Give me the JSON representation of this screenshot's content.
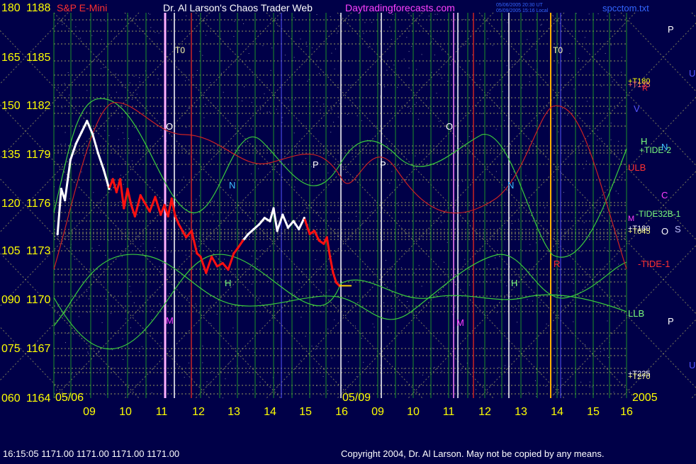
{
  "header": {
    "left_title": "S&P E-Mini",
    "center_title": "Dr. Al Larson's Chaos Trader Web",
    "site": "Daytradingforecasts.com",
    "stamp_lines": [
      "05/06/2005 20:30 UT",
      "05/09/2005 15:16 Local"
    ],
    "file_name": "spcctom.txt"
  },
  "colors": {
    "background": "#000048",
    "axis_label": "#ffff00",
    "grid_yellow": "#c8c864",
    "grid_green": "#22aa22",
    "price_white": "#ffffff",
    "price_red": "#ff1010",
    "curve_green": "#3ccc3c",
    "curve_red": "#cc2222",
    "site_magenta": "#ff40ff",
    "header_white": "#ffffff",
    "header_red": "#ff3030",
    "file_blue": "#3366ff"
  },
  "footer": {
    "quote": "16:15:05  1171.00 1171.00 1171.00 1171.00",
    "copyright": "Copyright 2004, Dr. Al Larson. May not be copied by any means."
  },
  "chart_data": {
    "type": "line",
    "title": "S&P E-Mini",
    "date_labels": [
      "05/06",
      "05/09"
    ],
    "year": "2005",
    "x_ticks": [
      "09",
      "10",
      "11",
      "12",
      "13",
      "14",
      "15",
      "16",
      "09",
      "10",
      "11",
      "12",
      "13",
      "14",
      "15",
      "16"
    ],
    "y_axis_left": {
      "ticks": [
        "180",
        "165",
        "150",
        "135",
        "120",
        "105",
        "090",
        "075",
        "060"
      ],
      "price_ticks": [
        "1188",
        "1185",
        "1182",
        "1179",
        "1176",
        "1173",
        "1170",
        "1167",
        "1164"
      ],
      "ylim": [
        1164,
        1188
      ]
    },
    "series": [
      {
        "name": "price",
        "points": [
          [
            8.1,
            1174.2
          ],
          [
            8.2,
            1177.0
          ],
          [
            8.3,
            1176.3
          ],
          [
            8.45,
            1178.8
          ],
          [
            8.6,
            1179.8
          ],
          [
            8.75,
            1180.5
          ],
          [
            8.9,
            1181.2
          ],
          [
            9.05,
            1180.4
          ],
          [
            9.2,
            1179.2
          ],
          [
            9.35,
            1178.2
          ],
          [
            9.5,
            1177.0
          ],
          [
            9.6,
            1177.6
          ],
          [
            9.7,
            1176.8
          ],
          [
            9.8,
            1177.6
          ],
          [
            9.9,
            1175.8
          ],
          [
            10.0,
            1177.0
          ],
          [
            10.1,
            1176.0
          ],
          [
            10.2,
            1175.3
          ],
          [
            10.35,
            1176.6
          ],
          [
            10.5,
            1176.0
          ],
          [
            10.6,
            1175.6
          ],
          [
            10.75,
            1176.5
          ],
          [
            10.9,
            1175.4
          ],
          [
            11.0,
            1176.0
          ],
          [
            11.1,
            1175.3
          ],
          [
            11.2,
            1176.4
          ],
          [
            11.3,
            1175.3
          ],
          [
            11.4,
            1174.8
          ],
          [
            11.5,
            1174.4
          ],
          [
            11.6,
            1174.0
          ],
          [
            11.75,
            1174.4
          ],
          [
            11.9,
            1173.0
          ],
          [
            12.0,
            1172.8
          ],
          [
            12.15,
            1171.8
          ],
          [
            12.3,
            1172.8
          ],
          [
            12.45,
            1172.2
          ],
          [
            12.6,
            1172.4
          ],
          [
            12.75,
            1172.0
          ],
          [
            12.9,
            1173.0
          ],
          [
            13.0,
            1173.3
          ],
          [
            13.15,
            1173.8
          ],
          [
            13.3,
            1174.2
          ],
          [
            13.45,
            1174.5
          ],
          [
            13.6,
            1174.8
          ],
          [
            13.75,
            1175.2
          ],
          [
            13.9,
            1175.0
          ],
          [
            14.0,
            1175.8
          ],
          [
            14.1,
            1174.4
          ],
          [
            14.25,
            1175.4
          ],
          [
            14.4,
            1174.6
          ],
          [
            14.55,
            1175.0
          ],
          [
            14.7,
            1174.5
          ],
          [
            14.85,
            1175.2
          ],
          [
            15.0,
            1174.2
          ],
          [
            15.15,
            1174.4
          ],
          [
            15.3,
            1173.8
          ],
          [
            15.45,
            1173.6
          ],
          [
            15.55,
            1174.0
          ],
          [
            15.65,
            1172.8
          ],
          [
            15.75,
            1171.8
          ],
          [
            15.85,
            1171.2
          ],
          [
            15.95,
            1171.0
          ]
        ]
      }
    ],
    "line_labels": [
      "+T180",
      "+T135",
      "ULB",
      "+TIDE-2",
      "-TIDE32B-1",
      "+T180",
      "+T045",
      "-TIDE-1",
      "LLB",
      "+T225",
      "+T270",
      "H",
      "N",
      "C",
      "M",
      "S",
      "O",
      "P",
      "P",
      "R",
      "V",
      "U",
      "U",
      "T0",
      "T0",
      "O",
      "O",
      "N",
      "N",
      "P",
      "P",
      "H",
      "H",
      "M",
      "M",
      "R"
    ],
    "grid": true
  }
}
